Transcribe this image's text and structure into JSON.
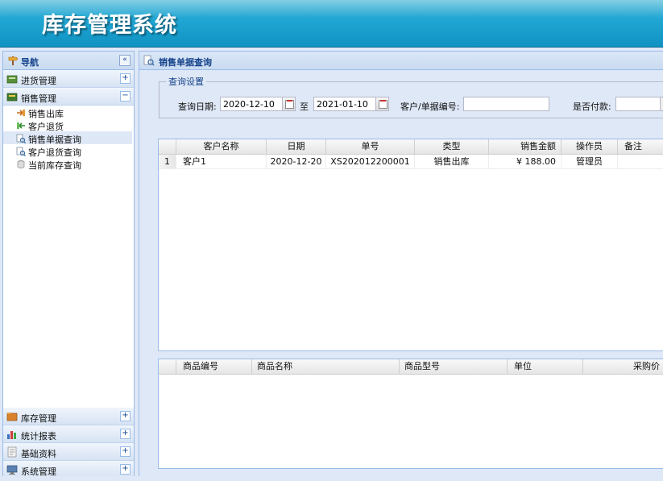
{
  "app": {
    "title": "库存管理系统"
  },
  "sidebar": {
    "header": "导航",
    "groups": [
      {
        "label": "进货管理",
        "state": "+"
      },
      {
        "label": "销售管理",
        "state": "−"
      },
      {
        "label": "库存管理",
        "state": "+"
      },
      {
        "label": "统计报表",
        "state": "+"
      },
      {
        "label": "基础资料",
        "state": "+"
      },
      {
        "label": "系统管理",
        "state": "+"
      }
    ],
    "sales_items": [
      {
        "label": "销售出库",
        "icon": "sales-out-icon"
      },
      {
        "label": "客户退货",
        "icon": "customer-return-icon"
      },
      {
        "label": "销售单据查询",
        "icon": "search-doc-icon",
        "selected": true
      },
      {
        "label": "客户退货查询",
        "icon": "search-doc-icon"
      },
      {
        "label": "当前库存查询",
        "icon": "database-icon"
      }
    ]
  },
  "main": {
    "tab_title": "销售单据查询",
    "query": {
      "legend": "查询设置",
      "date_label": "查询日期:",
      "date_from": "2020-12-10",
      "to_label": "至",
      "date_to": "2021-01-10",
      "customer_label": "客户/单据编号:",
      "customer_value": "",
      "paid_label": "是否付款:",
      "paid_value": ""
    },
    "orders_grid": {
      "columns": [
        "客户名称",
        "日期",
        "单号",
        "类型",
        "销售金额",
        "操作员",
        "备注"
      ],
      "rows": [
        {
          "num": "1",
          "customer": "客户1",
          "date": "2020-12-20",
          "order_no": "XS202012200001",
          "type": "销售出库",
          "amount": "¥ 188.00",
          "operator": "管理员",
          "remark": ""
        }
      ]
    },
    "items_grid": {
      "columns": [
        "商品编号",
        "商品名称",
        "商品型号",
        "单位",
        "采购价"
      ]
    }
  },
  "colors": {
    "header_blue": "#22a7d4",
    "panel_border": "#99bbe8",
    "title_text": "#15428b"
  }
}
